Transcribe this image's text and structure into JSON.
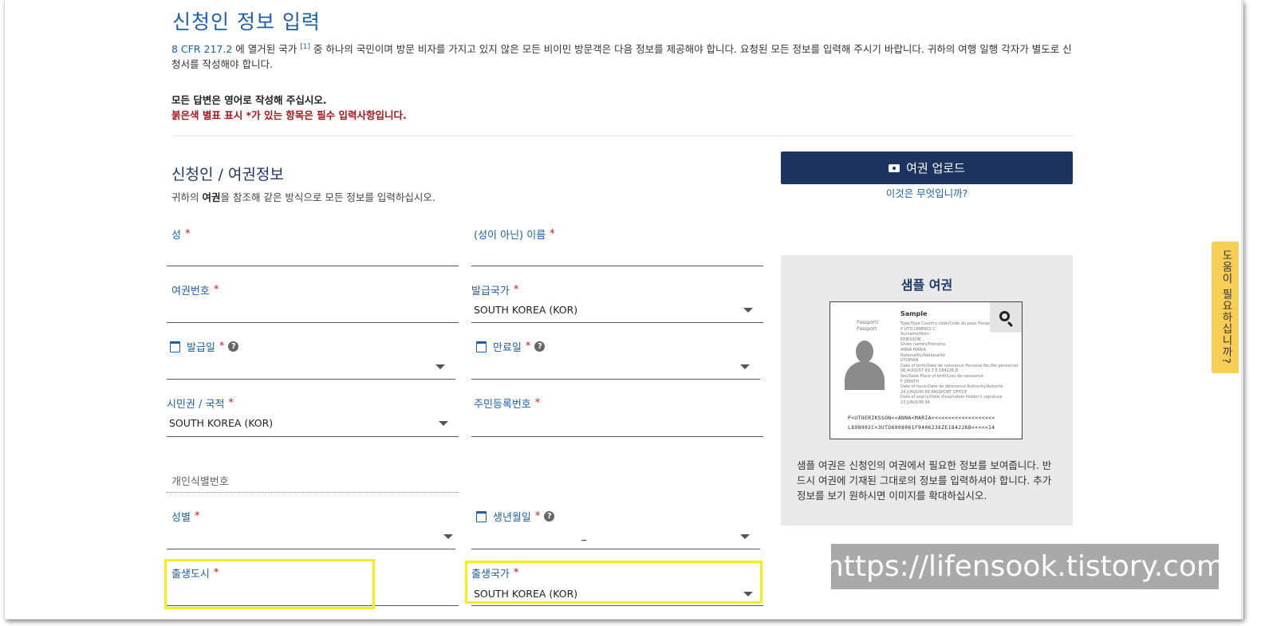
{
  "page": {
    "title": "신청인 정보 입력",
    "intro_cfr": "8 CFR 217.2",
    "intro_cfr_ref": "[1]",
    "intro_text_a": " 에 열거된 국가",
    "intro_text_b": " 중 하나의 국민이며 방문 비자를 가지고 있지 않은 모든 비이민 방문객은 다음 정보를 제공해야 합니다. 요청된 모든 정보를 입력해 주시기 바랍니다. 귀하의 여행 일행 각자가 별도로 신청서를 작성해야 합니다.",
    "note_english": "모든 답변은 영어로 작성해 주십시오.",
    "note_required": "붉은색 별표 표시 *가 있는 항목은 필수 입력사항입니다."
  },
  "section": {
    "title": "신청인 / 여권정보",
    "subtitle_a": "귀하의 ",
    "subtitle_bold": "여권",
    "subtitle_b": "을 참조해 같은 방식으로 모든 정보를 입력하십시오."
  },
  "required_mark": "*",
  "help_glyph": "?",
  "form": {
    "surname": {
      "label": "성",
      "value": ""
    },
    "given_name": {
      "label": "(성이 아닌) 이름",
      "value": ""
    },
    "passport_number": {
      "label": "여권번호",
      "value": ""
    },
    "issuing_country": {
      "label": "발급국가",
      "value": "SOUTH KOREA (KOR)"
    },
    "issue_date": {
      "label": "발급일",
      "value": ""
    },
    "expiry_date": {
      "label": "만료일",
      "value": ""
    },
    "citizenship": {
      "label": "시민권 / 국적",
      "value": "SOUTH KOREA (KOR)"
    },
    "national_id": {
      "label": "주민등록번호",
      "value": ""
    },
    "personal_id": {
      "label": "개인식별번호",
      "value": ""
    },
    "gender": {
      "label": "성별",
      "value": ""
    },
    "birth_date": {
      "label": "생년월일",
      "value": "_"
    },
    "birth_city": {
      "label": "출생도시",
      "value": ""
    },
    "birth_country": {
      "label": "출생국가",
      "value": "SOUTH KOREA (KOR)"
    }
  },
  "upload": {
    "button_label": "여권 업로드",
    "icon": "camera-icon",
    "what_link": "이것은 무엇입니까?"
  },
  "sample": {
    "title": "샘플 여권",
    "passport_heading": "Sample",
    "passport_label": "Passport/\nPassport",
    "passport_lines": [
      "Type/Type    Country code/Code du pays    Passport No./No. de passeport",
      "P             UTO                          L898902 C",
      "Surname/Nom",
      "ERIKSSON",
      "Given names/Prénoms",
      "ANNA MARIA",
      "Nationality/Nationalité",
      "UTOPIAN",
      "Date of birth/Date de naissance        Personal No./No personnel",
      "06 AUGUST 69                              Z E 184226 B",
      "Sex/Sexe    Place of birth/Lieu de naissance",
      "F            ZENITH",
      "Date of issue/Date de délivrance       Authority/Autorité",
      "24 JUN/JUIN 89                      PASSPORT OFFICE",
      "Date of expiry/Date d'expiration      Holder's signature",
      "23 JUN/JUIN 94"
    ],
    "mrz_1": "P<UTOERIKSSON<<ANNA<MARIA<<<<<<<<<<<<<<<<<<<",
    "mrz_2": "L898902C<3UTO6908061F9406236ZE184226B<<<<<14",
    "zoom_icon": "search-icon",
    "description": "샘플 여권은 신청인의 여권에서 필요한 정보를 보여줍니다. 반드시 여권에 기재된 그대로의 정보를 입력하셔야 합니다. 추가 정보를 보기 원하시면 이미지를 확대하십시오."
  },
  "help_tab": {
    "label": "도움이 필요하십니까?"
  },
  "watermark": "https://lifensook.tistory.com",
  "colors": {
    "link_blue": "#1b5fa8",
    "navy": "#1d3461",
    "required_red": "#c0191e",
    "highlight_yellow": "#f7ee17",
    "help_tab": "#f8cf56"
  }
}
